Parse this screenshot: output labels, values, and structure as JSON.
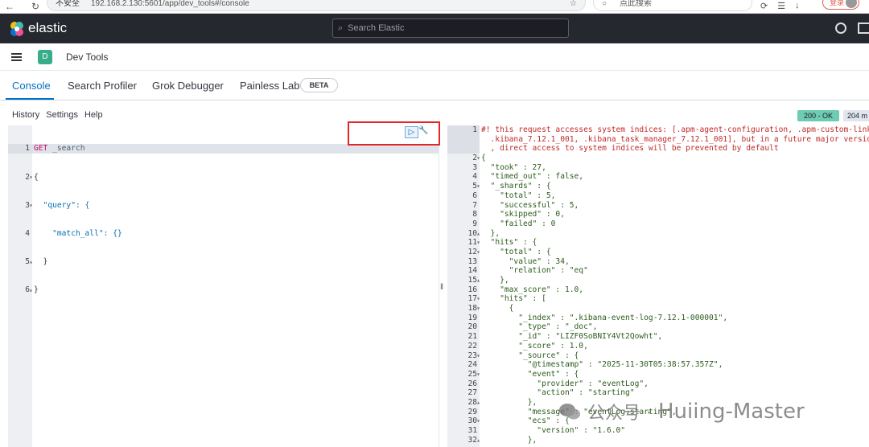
{
  "browser": {
    "insecure_label": "不安全",
    "url": "192.168.2.130:5601/app/dev_tools#/console",
    "search_placeholder": "点此搜索",
    "login_label": "登录"
  },
  "header": {
    "brand": "elastic",
    "search_placeholder": "Search Elastic"
  },
  "appbar": {
    "space_initial": "D",
    "breadcrumb": "Dev Tools"
  },
  "tabs": [
    {
      "label": "Console",
      "active": true
    },
    {
      "label": "Search Profiler",
      "active": false
    },
    {
      "label": "Grok Debugger",
      "active": false
    },
    {
      "label": "Painless Lab",
      "active": false
    }
  ],
  "beta_badge": "BETA",
  "console_menu": {
    "history": "History",
    "settings": "Settings",
    "help": "Help"
  },
  "response_status": {
    "code": "200 - OK",
    "time": "204 m"
  },
  "request_editor": {
    "line_numbers": [
      "1",
      "2",
      "3",
      "4",
      "5",
      "6"
    ],
    "method": "GET",
    "path": "_search",
    "lines": [
      "{",
      "  \"query\": {",
      "    \"match_all\": {}",
      "  }",
      "}"
    ]
  },
  "response_editor": {
    "line_numbers": [
      "1",
      "2",
      "3",
      "4",
      "5",
      "6",
      "7",
      "8",
      "9",
      "10",
      "11",
      "12",
      "13",
      "14",
      "15",
      "16",
      "17",
      "18",
      "19",
      "20",
      "21",
      "22",
      "23",
      "24",
      "25",
      "26",
      "27",
      "28",
      "29",
      "30",
      "31",
      "32"
    ],
    "warning_lines": [
      "#! this request accesses system indices: [.apm-agent-configuration, .apm-custom-link,",
      "  .kibana_7.12.1_001, .kibana_task_manager_7.12.1_001], but in a future major version",
      "  , direct access to system indices will be prevented by default"
    ],
    "lines": [
      "{",
      "  \"took\" : 27,",
      "  \"timed_out\" : false,",
      "  \"_shards\" : {",
      "    \"total\" : 5,",
      "    \"successful\" : 5,",
      "    \"skipped\" : 0,",
      "    \"failed\" : 0",
      "  },",
      "  \"hits\" : {",
      "    \"total\" : {",
      "      \"value\" : 34,",
      "      \"relation\" : \"eq\"",
      "    },",
      "    \"max_score\" : 1.0,",
      "    \"hits\" : [",
      "      {",
      "        \"_index\" : \".kibana-event-log-7.12.1-000001\",",
      "        \"_type\" : \"_doc\",",
      "        \"_id\" : \"LIZF0SoBNIY4Vt2Qowht\",",
      "        \"_score\" : 1.0,",
      "        \"_source\" : {",
      "          \"@timestamp\" : \"2025-11-30T05:38:57.357Z\",",
      "          \"event\" : {",
      "            \"provider\" : \"eventLog\",",
      "            \"action\" : \"starting\"",
      "          },",
      "          \"message\" : \"eventLog starting\",",
      "          \"ecs\" : {",
      "            \"version\" : \"1.6.0\"",
      "          },"
    ]
  },
  "watermark": {
    "cn": "公众号 ·",
    "name": "Huiing-Master"
  }
}
